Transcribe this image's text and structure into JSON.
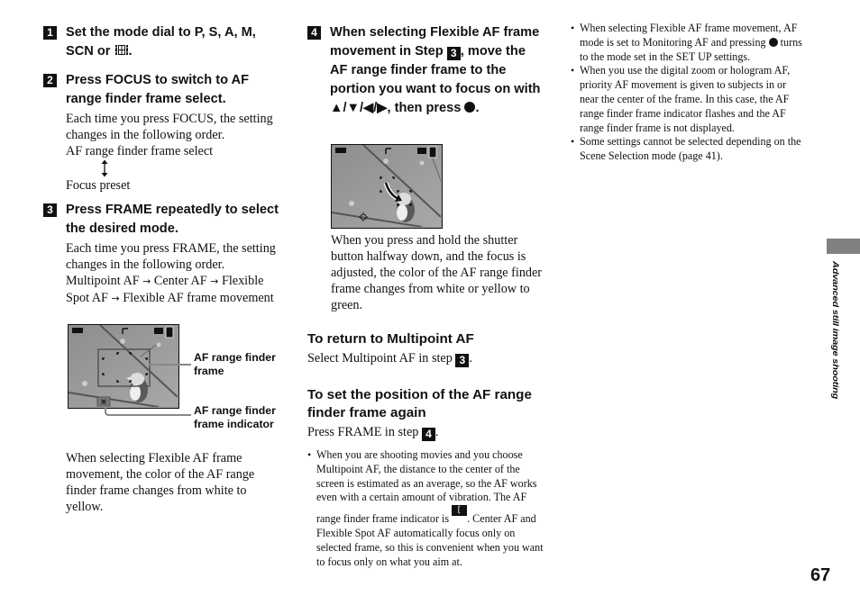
{
  "steps": [
    {
      "number": "1",
      "heading": "Set the mode dial to P, S, A, M, SCN or",
      "heading_icon": "movie-mode-icon",
      "heading_end": "."
    },
    {
      "number": "2",
      "heading": "Press FOCUS to switch to AF range finder frame select.",
      "body": "Each time you press FOCUS, the setting changes in the following order.",
      "sequence": [
        "AF range finder frame select",
        "Focus preset"
      ],
      "sequence_icon": "up-down-arrow-icon"
    },
    {
      "number": "3",
      "heading": "Press FRAME repeatedly to select the desired mode.",
      "body": "Each time you press FRAME, the setting changes in the following order.",
      "modes": [
        "Multipoint AF",
        "Center AF",
        "Flexible Spot AF",
        "Flexible AF frame movement"
      ],
      "mode_arrow": "→",
      "callouts": [
        "AF range finder frame",
        "AF range finder frame indicator"
      ],
      "note": "When selecting Flexible AF frame movement, the color of the AF range finder frame changes from white to yellow."
    },
    {
      "number": "4",
      "heading_part1": "When selecting Flexible AF frame movement in Step",
      "heading_ref": "3",
      "heading_part2": ", move the AF range finder frame to the portion you want to focus on with ▲/▼/◀/▶, then press",
      "heading_end": ".",
      "body": "When you press and hold the shutter button halfway down, and the focus is adjusted, the color of the AF range finder frame changes from white or yellow to green."
    }
  ],
  "sections": [
    {
      "heading": "To return to Multipoint AF",
      "body": "Select Multipoint AF in step",
      "ref": "3",
      "end": "."
    },
    {
      "heading": "To set the position of the AF range finder frame again",
      "body": "Press FRAME in step",
      "ref": "4",
      "end": "."
    }
  ],
  "middle_note": {
    "part1": "When you are shooting movies and you choose Multipoint AF, the distance to the center of the screen is estimated as an average, so the AF works even with a certain amount of vibration. The AF range finder frame indicator is",
    "indicator": "[ ]",
    "part2": ". Center AF and Flexible Spot AF automatically focus only on selected frame, so this is convenient when you want to focus only on what you aim at."
  },
  "right_notes": [
    {
      "part1": "When selecting Flexible AF frame movement, AF mode is set to Monitoring AF and pressing",
      "part2": "turns to the mode set in the SET UP settings."
    },
    {
      "text": "When you use the digital zoom or hologram AF, priority AF movement is given to subjects in or near the center of the frame. In this case, the AF range finder frame indicator flashes and the AF range finder frame is not displayed."
    },
    {
      "text": "Some settings cannot be selected depending on the Scene Selection mode (page 41)."
    }
  ],
  "sidebar": {
    "section_label": "Advanced still image shooting",
    "tab_color": "#808080"
  },
  "page_number": "67"
}
